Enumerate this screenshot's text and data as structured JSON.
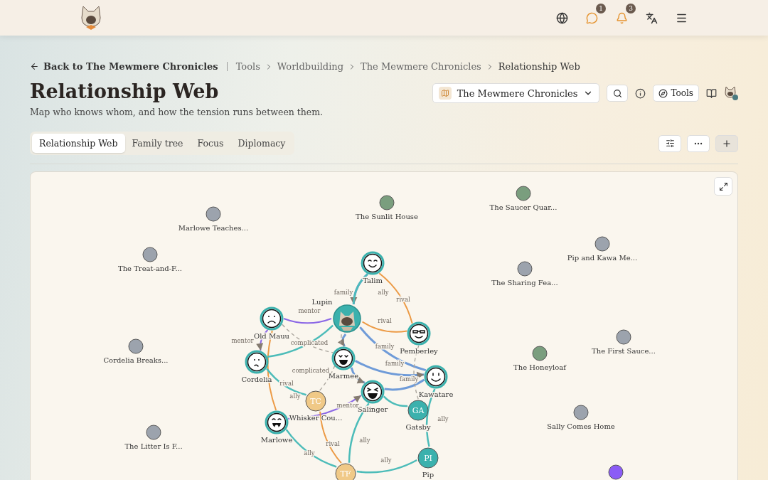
{
  "header": {
    "notifications": [
      {
        "kind": "globe"
      },
      {
        "kind": "messages",
        "badge": "1"
      },
      {
        "kind": "bell",
        "badge": "3"
      },
      {
        "kind": "translate"
      },
      {
        "kind": "menu"
      }
    ]
  },
  "breadcrumb": {
    "back": "Back to The Mewmere Chronicles",
    "items": [
      "Tools",
      "Worldbuilding",
      "The Mewmere Chronicles",
      "Relationship Web"
    ]
  },
  "title": "Relationship Web",
  "subtitle": "Map who knows whom, and how the tension runs between them.",
  "project_select": {
    "value": "The Mewmere Chronicles"
  },
  "tools_button": "Tools",
  "tabs": [
    {
      "label": "Relationship Web",
      "selected": true
    },
    {
      "label": "Family tree",
      "selected": false
    },
    {
      "label": "Focus",
      "selected": false
    },
    {
      "label": "Diplomacy",
      "selected": false
    }
  ],
  "graph": {
    "nodes": [
      {
        "kind": "event",
        "label": "Marlowe Teaches...",
        "color": "#9ca3ad"
      },
      {
        "kind": "event",
        "label": "The Sunlit House",
        "color": "#7a9e7e"
      },
      {
        "kind": "event",
        "label": "The Saucer Quar...",
        "color": "#7a9e7e"
      },
      {
        "kind": "event",
        "label": "Pip and Kawa Me...",
        "color": "#9ca3ad"
      },
      {
        "kind": "event",
        "label": "The Treat-and-F...",
        "color": "#9ca3ad"
      },
      {
        "kind": "event",
        "label": "The Sharing Fea...",
        "color": "#9ca3ad"
      },
      {
        "kind": "event",
        "label": "Cordelia Breaks...",
        "color": "#9ca3ad"
      },
      {
        "kind": "event",
        "label": "The First Sauce...",
        "color": "#9ca3ad"
      },
      {
        "kind": "event",
        "label": "The Honeyloaf",
        "color": "#7a9e7e"
      },
      {
        "kind": "event",
        "label": "Sally Comes Home",
        "color": "#9ca3ad"
      },
      {
        "kind": "event",
        "label": "The Litter Is F...",
        "color": "#9ca3ad"
      },
      {
        "kind": "event",
        "color": "#8b5cf6"
      },
      {
        "kind": "face",
        "label": "Talim"
      },
      {
        "label": "Lupin"
      },
      {
        "kind": "face",
        "label": "Old Mauu"
      },
      {
        "kind": "face",
        "label": "Pemberley"
      },
      {
        "kind": "face",
        "label": "Marmee"
      },
      {
        "kind": "face",
        "label": "Cordelia"
      },
      {
        "kind": "face",
        "label": "Kawatare"
      },
      {
        "kind": "initials",
        "initials": "TC",
        "label": "Whisker Cou...",
        "color": "#f0c987"
      },
      {
        "kind": "face",
        "label": "Salinger"
      },
      {
        "kind": "face",
        "label": "Marlowe"
      },
      {
        "kind": "initials",
        "initials": "GA",
        "label": "Gatsby",
        "color": "#3bb1ad"
      },
      {
        "kind": "initials",
        "initials": "PI",
        "label": "Pip",
        "color": "#3bb1ad"
      },
      {
        "kind": "initials",
        "initials": "TF",
        "color": "#f0c987"
      }
    ],
    "edges": [
      {
        "kind": "family",
        "label": "family",
        "arrow": true
      },
      {
        "kind": "ally",
        "label": "ally"
      },
      {
        "kind": "rival",
        "label": "rival"
      },
      {
        "kind": "mentor",
        "label": "mentor"
      },
      {
        "kind": "complicated",
        "label": "complicated"
      },
      {
        "kind": "mentor",
        "label": "mentor",
        "arrow": true
      },
      {
        "kind": "rival",
        "label": "rival"
      },
      {
        "kind": "family",
        "label": "family"
      },
      {
        "kind": "family",
        "arrow": true
      },
      {
        "kind": "rival",
        "label": "rival"
      },
      {
        "kind": "ally"
      },
      {
        "kind": "complicated",
        "label": "complicated"
      },
      {
        "kind": "ally",
        "label": "ally"
      },
      {
        "kind": "family",
        "label": "family",
        "arrow": true
      },
      {
        "kind": "family",
        "arrow": true
      },
      {
        "kind": "family",
        "label": "family"
      },
      {
        "kind": "complicated"
      },
      {
        "kind": "mentor",
        "label": "mentor",
        "arrow": true
      },
      {
        "kind": "rival",
        "label": "rival"
      },
      {
        "kind": "ally",
        "label": "ally"
      },
      {
        "kind": "ally",
        "label": "ally"
      },
      {
        "kind": "ally"
      },
      {
        "kind": "ally",
        "label": "ally"
      },
      {
        "kind": "ally",
        "label": "ally"
      }
    ]
  }
}
